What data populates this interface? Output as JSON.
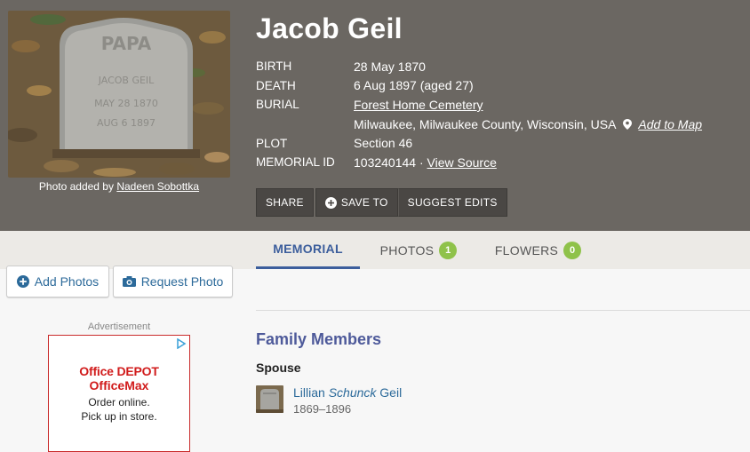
{
  "memorial": {
    "name": "Jacob Geil",
    "photo_caption_prefix": "Photo added by",
    "photo_added_by": "Nadeen Sobottka",
    "headstone_text": {
      "top": "PAPA",
      "line1": "JACOB GEIL",
      "line2": "MAY 28 1870",
      "line3": "AUG 6 1897"
    }
  },
  "facts": {
    "birth_label": "BIRTH",
    "birth_value": "28 May 1870",
    "death_label": "DEATH",
    "death_value": "6 Aug 1897 (aged 27)",
    "burial_label": "BURIAL",
    "burial_cemetery": "Forest Home Cemetery",
    "burial_location": "Milwaukee, Milwaukee County, Wisconsin, USA",
    "add_to_map": "Add to Map",
    "plot_label": "PLOT",
    "plot_value": "Section 46",
    "memorial_id_label": "MEMORIAL ID",
    "memorial_id_value": "103240144 ·",
    "view_source": "View Source"
  },
  "actions": {
    "share": "SHARE",
    "save_to": "SAVE TO",
    "suggest_edits": "SUGGEST EDITS"
  },
  "tabs": [
    {
      "label": "MEMORIAL",
      "active": true
    },
    {
      "label": "PHOTOS",
      "badge": "1"
    },
    {
      "label": "FLOWERS",
      "badge": "0"
    }
  ],
  "sidebar": {
    "add_photos": "Add Photos",
    "request_photo": "Request Photo"
  },
  "ad": {
    "label": "Advertisement",
    "brand_line1": "Office DEPOT",
    "brand_line2": "OfficeMax",
    "text_line1": "Order online.",
    "text_line2": "Pick up in store."
  },
  "family": {
    "title": "Family Members",
    "relation": "Spouse",
    "member_first": "Lillian",
    "member_maiden": "Schunck",
    "member_last": "Geil",
    "member_dates": "1869–1896"
  },
  "colors": {
    "header_bg": "#6b6762",
    "link": "#2c6a9a",
    "tab_active": "#3c5e9c",
    "badge": "#8fc24a",
    "section_title": "#4e5a9a"
  }
}
